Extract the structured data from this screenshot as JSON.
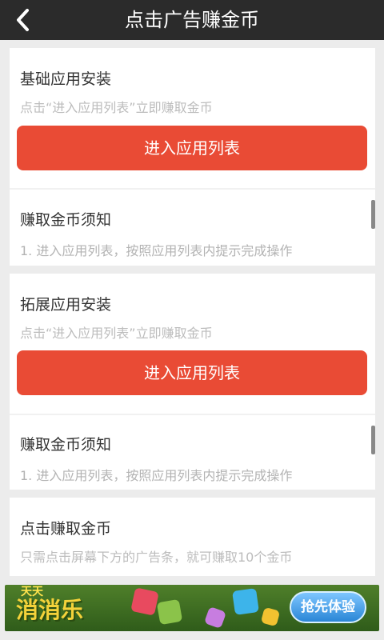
{
  "header": {
    "title": "点击广告赚金币",
    "back_icon": "back-arrow-icon"
  },
  "sections": [
    {
      "title": "基础应用安装",
      "subtitle": "点击“进入应用列表”立即赚取金币",
      "button_label": "进入应用列表",
      "notice_title": "赚取金币须知",
      "notice_text": "1. 进入应用列表，按照应用列表内提示完成操作"
    },
    {
      "title": "拓展应用安装",
      "subtitle": "点击“进入应用列表”立即赚取金币",
      "button_label": "进入应用列表",
      "notice_title": "赚取金币须知",
      "notice_text": "1. 进入应用列表，按照应用列表内提示完成操作"
    }
  ],
  "ad_section": {
    "title": "点击赚取金币",
    "subtitle": "只需点击屏幕下方的广告条，就可赚取10个金币"
  },
  "banner": {
    "game_title": "消消乐",
    "game_tag": "天天",
    "cta": "抢先体验"
  },
  "colors": {
    "accent": "#e94b35",
    "header_bg": "#2b2b2b",
    "page_bg": "#ececec"
  }
}
